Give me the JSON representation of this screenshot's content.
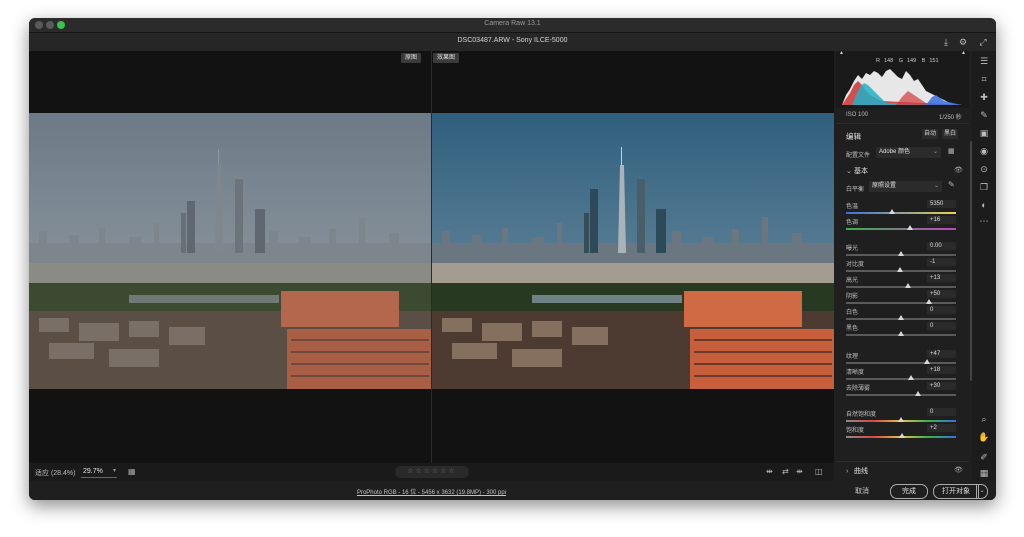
{
  "app": {
    "title": "Camera Raw 13.1"
  },
  "file": {
    "title": "DSC03487.ARW  -  Sony ILCE-5000"
  },
  "viewer": {
    "before_label": "原图",
    "after_label": "效果图"
  },
  "histogram": {
    "r_label": "R",
    "r": "148",
    "g_label": "G",
    "g": "149",
    "b_label": "B",
    "b": "151",
    "iso": "ISO 100",
    "shutter": "1/250 秒"
  },
  "edit": {
    "title": "编辑",
    "auto": "自动",
    "bw": "黑白"
  },
  "profile": {
    "label": "配置文件",
    "value": "Adobe 颜色"
  },
  "basic": {
    "title": "基本",
    "wb_label": "白平衡",
    "wb_value": "原照设置",
    "sliders": [
      {
        "label": "色温",
        "value": "5350",
        "position": 0.42
      },
      {
        "label": "色调",
        "value": "+16",
        "position": 0.58
      },
      {
        "label": "曝光",
        "value": "0.00",
        "position": 0.5
      },
      {
        "label": "对比度",
        "value": "-1",
        "position": 0.495
      },
      {
        "label": "高光",
        "value": "+13",
        "position": 0.565
      },
      {
        "label": "阴影",
        "value": "+50",
        "position": 0.75
      },
      {
        "label": "白色",
        "value": "0",
        "position": 0.5
      },
      {
        "label": "黑色",
        "value": "0",
        "position": 0.5
      },
      {
        "label": "纹理",
        "value": "+47",
        "position": 0.735
      },
      {
        "label": "清晰度",
        "value": "+18",
        "position": 0.59
      },
      {
        "label": "去除薄雾",
        "value": "+30",
        "position": 0.65
      },
      {
        "label": "自然饱和度",
        "value": "0",
        "position": 0.5
      },
      {
        "label": "饱和度",
        "value": "+2",
        "position": 0.51
      }
    ]
  },
  "curve": {
    "title": "曲线"
  },
  "status": {
    "fit_label": "适应 (28.4%)",
    "zoom": "29.7%",
    "stars": "☆☆☆☆☆☆"
  },
  "footer": {
    "info": "ProPhoto RGB - 16 位 - 5456 x 3632 (19.8MP) - 300 ppi",
    "cancel": "取消",
    "done": "完成",
    "open": "打开对象"
  },
  "colors": {
    "accent_green": "#3cc14a",
    "panel_bg": "#1f1f1f",
    "viewer_bg": "#121212"
  }
}
